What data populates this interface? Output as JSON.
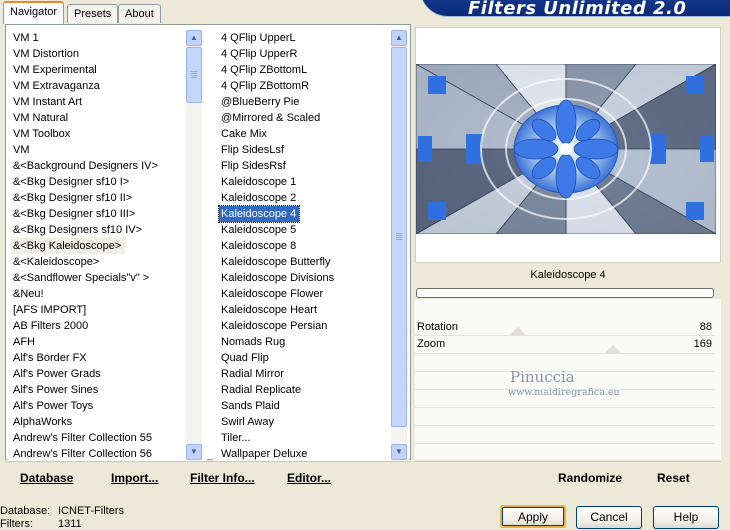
{
  "tabs": [
    "Navigator",
    "Presets",
    "About"
  ],
  "banner_title": "Filters Unlimited 2.0",
  "categories": [
    "VM 1",
    "VM Distortion",
    "VM Experimental",
    "VM Extravaganza",
    "VM Instant Art",
    "VM Natural",
    "VM Toolbox",
    "VM",
    "&<Background Designers IV>",
    "&<Bkg Designer sf10 I>",
    "&<Bkg Designer sf10 II>",
    "&<Bkg Designer sf10 III>",
    "&<Bkg Designers sf10 IV>",
    "&<Bkg Kaleidoscope>",
    "&<Kaleidoscope>",
    "&<Sandflower Specials\"v\" >",
    "&Neu!",
    "[AFS IMPORT]",
    "AB Filters 2000",
    "AFH",
    "Alf's Border FX",
    "Alf's Power Grads",
    "Alf's Power Sines",
    "Alf's Power Toys",
    "AlphaWorks",
    "Andrew's Filter Collection 55",
    "Andrew's Filter Collection 56"
  ],
  "selected_category": "&<Bkg Kaleidoscope>",
  "filters": [
    "4 QFlip UpperL",
    "4 QFlip UpperR",
    "4 QFlip ZBottomL",
    "4 QFlip ZBottomR",
    "@BlueBerry Pie",
    "@Mirrored & Scaled",
    "Cake Mix",
    "Flip SidesLsf",
    "Flip SidesRsf",
    "Kaleidoscope 1",
    "Kaleidoscope 2",
    "Kaleidoscope 4",
    "Kaleidoscope 5",
    "Kaleidoscope 8",
    "Kaleidoscope Butterfly",
    "Kaleidoscope Divisions",
    "Kaleidoscope Flower",
    "Kaleidoscope Heart",
    "Kaleidoscope Persian",
    "Nomads Rug",
    "Quad Flip",
    "Radial Mirror",
    "Radial Replicate",
    "Sands Plaid",
    "Swirl Away",
    "Tiler...",
    "Wallpaper Deluxe"
  ],
  "selected_filter": "Kaleidoscope 4",
  "toolbar": {
    "database": "Database",
    "import": "Import...",
    "filter_info": "Filter Info...",
    "editor": "Editor...",
    "randomize": "Randomize",
    "reset": "Reset"
  },
  "preview": {
    "filter_name": "Kaleidoscope 4",
    "progress": 0
  },
  "params": [
    {
      "label": "Rotation",
      "value": "88"
    },
    {
      "label": "Zoom",
      "value": "169"
    }
  ],
  "watermark": {
    "line1": "Pinuccia",
    "line2": "www.maidiregrafica.eu"
  },
  "status": {
    "database_label": "Database:",
    "database_value": "ICNET-Filters",
    "filters_label": "Filters:",
    "filters_value": "1311"
  },
  "buttons": {
    "apply": "Apply",
    "cancel": "Cancel",
    "help": "Help"
  },
  "colors": {
    "selection": "#316ac5",
    "banner": "#0a2a78",
    "window_bg": "#ece9d8"
  }
}
